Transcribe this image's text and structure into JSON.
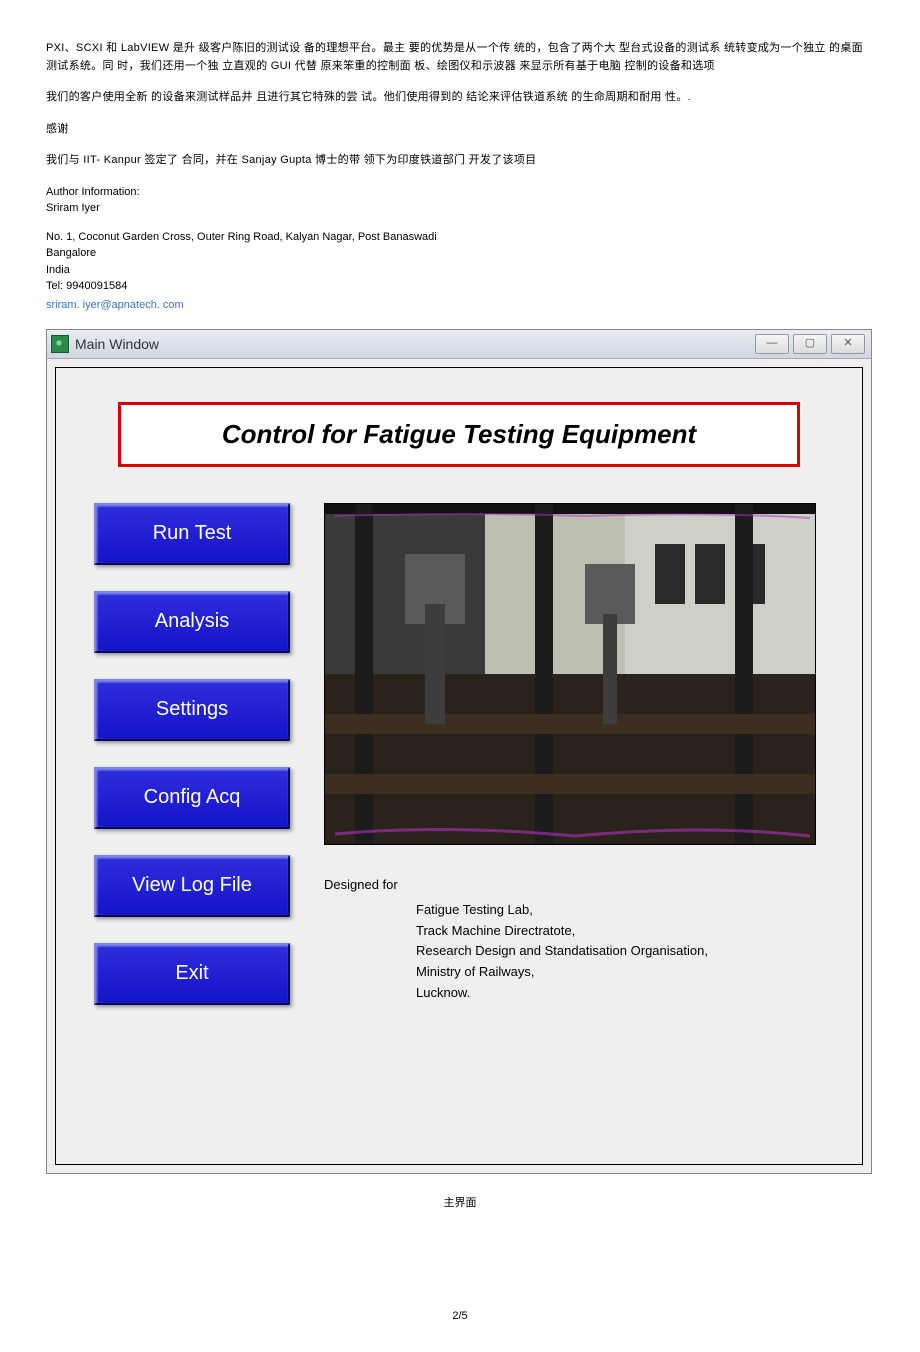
{
  "doc": {
    "para1": "PXI、SCXI 和 LabVIEW 是升 级客户陈旧的测试设 备的理想平台。最主 要的优势是从一个传 统的，包含了两个大 型台式设备的测试系 统转变成为一个独立 的桌面测试系统。同 时，我们还用一个独 立直观的 GUI 代替 原来笨重的控制面 板、绘图仪和示波器 来显示所有基于电脑 控制的设备和选项",
    "para2": "我们的客户使用全新 的设备来测试样品并 且进行其它特殊的尝 试。他们使用得到的 结论来评估铁道系统 的生命周期和耐用 性。.",
    "thanks": "感谢",
    "para3": "我们与 IIT- Kanpur 签定了 合同，并在 Sanjay Gupta 博士的带 领下为印度铁道部门 开发了该项目",
    "author_label": "Author Information:",
    "author_name": "Sriram Iyer",
    "addr1": "No. 1, Coconut Garden Cross, Outer Ring Road, Kalyan Nagar, Post Banaswadi",
    "addr2": "Bangalore",
    "addr3": "India",
    "tel": "Tel: 9940091584",
    "email": "sriram. iyer@apnatech. com",
    "caption": "主界面",
    "pagenum": "2/5"
  },
  "window": {
    "title": "Main Window",
    "banner": "Control for Fatigue Testing Equipment",
    "buttons": {
      "run": "Run Test",
      "analysis": "Analysis",
      "settings": "Settings",
      "config": "Config Acq",
      "viewlog": "View Log File",
      "exit": "Exit"
    },
    "designed_for": "Designed for",
    "org": {
      "l1": "Fatigue Testing Lab,",
      "l2": "Track Machine Directratote,",
      "l3": "Research Design and Standatisation Organisation,",
      "l4": "Ministry of Railways,",
      "l5": "Lucknow."
    }
  }
}
